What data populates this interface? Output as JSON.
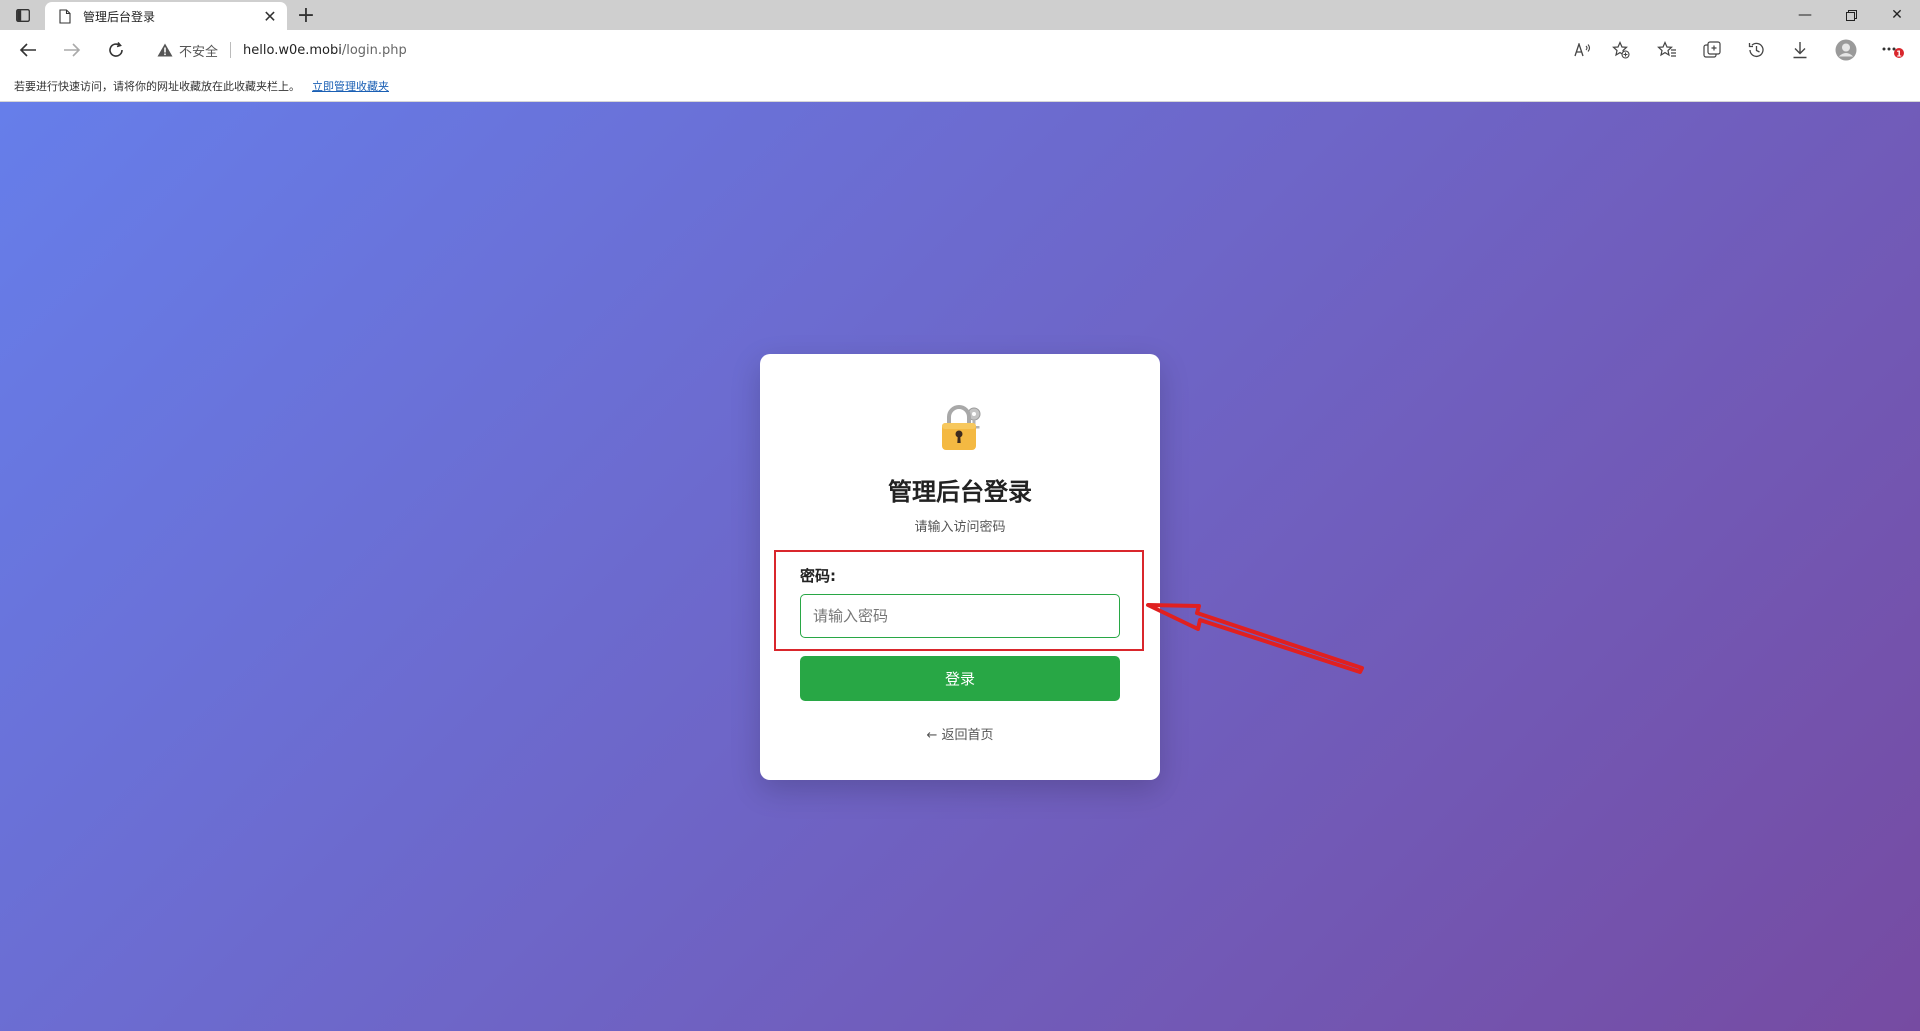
{
  "browser": {
    "tab": {
      "title": "管理后台登录"
    },
    "address": {
      "security_label": "不安全",
      "host": "hello.w0e.mobi",
      "path": "/login.php"
    },
    "bookmarks_bar": {
      "hint": "若要进行快速访问，请将你的网址收藏放在此收藏夹栏上。",
      "manage_link": "立即管理收藏夹"
    },
    "notification_badge": "1"
  },
  "login": {
    "title": "管理后台登录",
    "subtitle": "请输入访问密码",
    "password_label": "密码:",
    "password_placeholder": "请输入密码",
    "submit_label": "登录",
    "back_link": "← 返回首页"
  },
  "colors": {
    "gradient_start": "#667eea",
    "gradient_end": "#764ba2",
    "button": "#28a745",
    "highlight": "#d9262c"
  },
  "icons": {
    "page_icon": "lock-with-key-icon"
  }
}
